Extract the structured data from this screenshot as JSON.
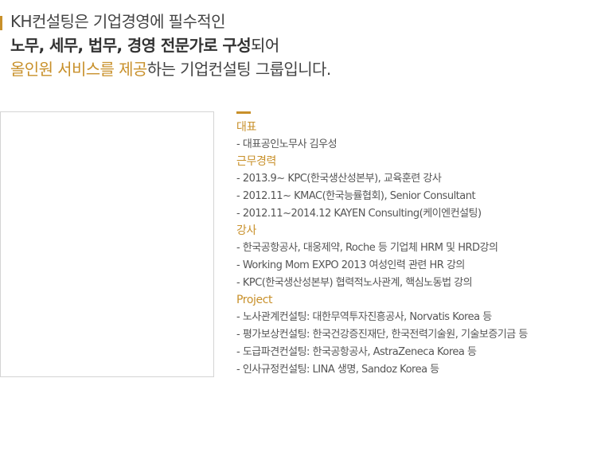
{
  "colors": {
    "accent": "#c8902a",
    "text": "#444444",
    "frame_border": "#d4d4d4"
  },
  "headline": {
    "line1": "KH컨설팅은 기업경영에 필수적인",
    "line2_bold": "노무, 세무, 법무, 경영 전문가로 구성",
    "line2_rest": "되어",
    "line3_accent": "올인원 서비스를 제공",
    "line3_rest": "하는 기업컨설팅 그룹입니다."
  },
  "profile": {
    "sections": [
      {
        "title": "대표",
        "items": [
          "- 대표공인노무사 김우성"
        ]
      },
      {
        "title": "근무경력",
        "items": [
          "- 2013.9~ KPC(한국생산성본부), 교육훈련 강사",
          "- 2012.11~ KMAC(한국능률협회), Senior Consultant",
          "- 2012.11~2014.12 KAYEN Consulting(케이엔컨설팅)"
        ]
      },
      {
        "title": "강사",
        "items": [
          "- 한국공항공사, 대웅제약, Roche 등 기업체 HRM 및 HRD강의",
          "- Working Mom EXPO 2013 여성인력 관련 HR 강의",
          "- KPC(한국생산성본부) 협력적노사관계, 핵심노동법 강의"
        ]
      },
      {
        "title": "Project",
        "items": [
          "- 노사관계컨설팅: 대한무역투자진흥공사, Norvatis Korea 등",
          "- 평가보상컨설팅: 한국건강증진재단, 한국전력기술원, 기술보증기금 등",
          "- 도급파견컨설팅: 한국공항공사, AstraZeneca Korea 등",
          "- 인사규정컨설팅: LINA 생명, Sandoz Korea 등"
        ]
      }
    ]
  }
}
